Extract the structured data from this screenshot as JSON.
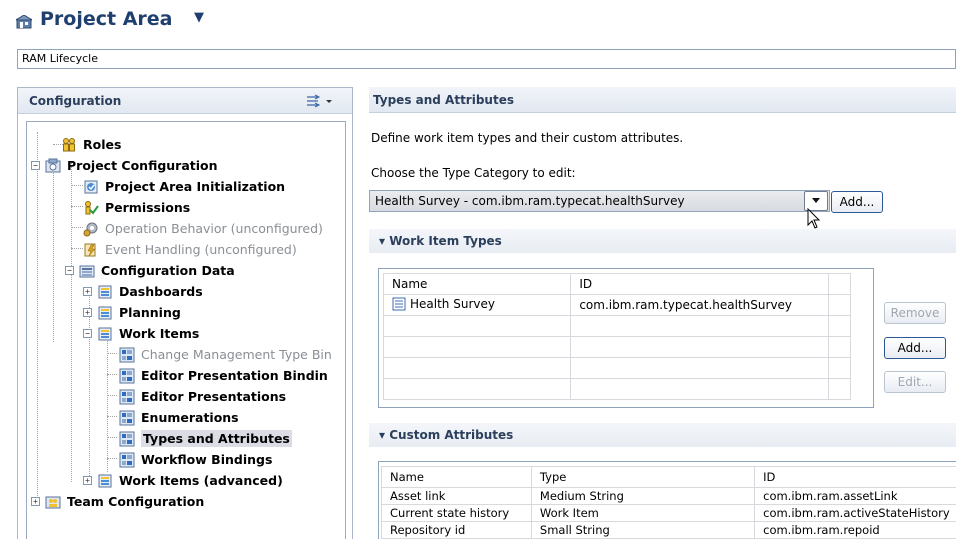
{
  "header": {
    "title": "Project Area",
    "caret": "▼",
    "icon": "project-area-icon"
  },
  "lifecycle": "RAM Lifecycle",
  "left": {
    "title": "Configuration",
    "tree": {
      "roles": "Roles",
      "project_configuration": "Project Configuration",
      "project_area_initialization": "Project Area Initialization",
      "permissions": "Permissions",
      "operation_behavior": "Operation Behavior (unconfigured)",
      "event_handling": "Event Handling (unconfigured)",
      "configuration_data": "Configuration Data",
      "dashboards": "Dashboards",
      "planning": "Planning",
      "work_items": "Work Items",
      "change_mgmt": "Change Management Type Bin",
      "editor_pres_binding": "Editor Presentation Bindin",
      "editor_presentations": "Editor Presentations",
      "enumerations": "Enumerations",
      "types_attributes": "Types and Attributes",
      "workflow_bindings": "Workflow Bindings",
      "work_items_adv": "Work Items (advanced)",
      "team_configuration": "Team Configuration"
    }
  },
  "right": {
    "title": "Types and Attributes",
    "description": "Define work item types and their custom attributes.",
    "choose_label": "Choose the Type Category to edit:",
    "type_category": "Health Survey - com.ibm.ram.typecat.healthSurvey",
    "add_label": "Add...",
    "work_item_types": {
      "title": "Work Item Types",
      "headers": [
        "Name",
        "ID"
      ],
      "rows": [
        {
          "name": "Health Survey",
          "id": "com.ibm.ram.typecat.healthSurvey"
        }
      ],
      "remove": "Remove",
      "add": "Add...",
      "edit": "Edit..."
    },
    "custom_attributes": {
      "title": "Custom Attributes",
      "headers": [
        "Name",
        "Type",
        "ID"
      ],
      "rows": [
        {
          "name": "Asset link",
          "type": "Medium String",
          "id": "com.ibm.ram.assetLink"
        },
        {
          "name": "Current state history",
          "type": "Work Item",
          "id": "com.ibm.ram.activeStateHistory"
        },
        {
          "name": "Repository id",
          "type": "Small String",
          "id": "com.ibm.ram.repoid"
        }
      ]
    }
  },
  "colors": {
    "title": "#1f3f6e",
    "section": "#2b3f5c",
    "border": "#8fa3bd"
  }
}
